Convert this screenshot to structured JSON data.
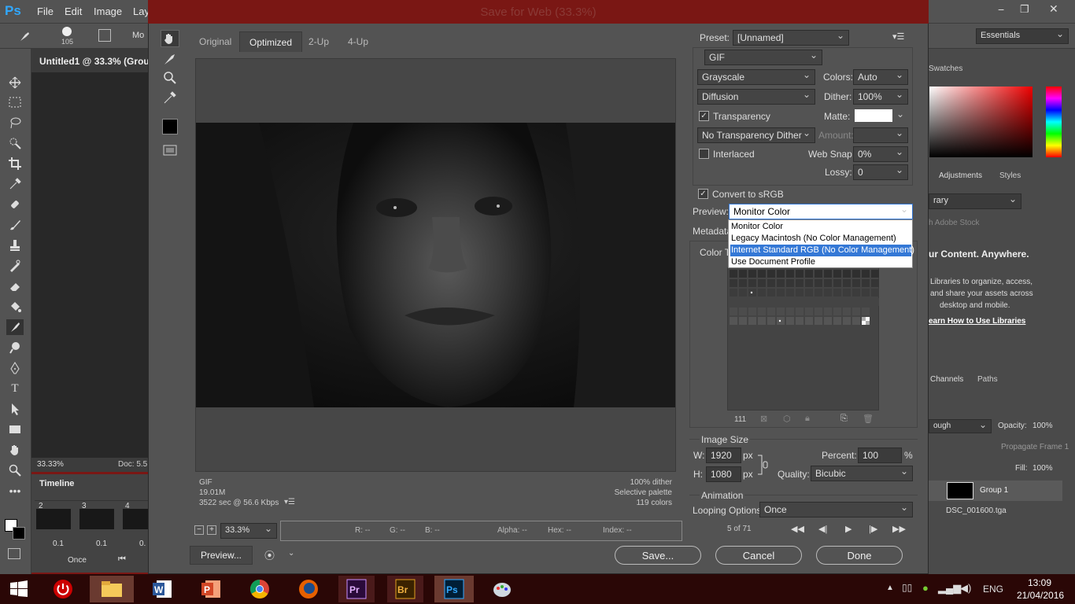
{
  "app": {
    "logo": "Ps",
    "menus": [
      "File",
      "Edit",
      "Image",
      "Lay"
    ],
    "brush_size": "105",
    "options_mode": "Mo",
    "workspace": "Essentials",
    "window_controls": [
      "−",
      "❐",
      "✕"
    ]
  },
  "document": {
    "tab_title": "Untitled1 @ 33.3% (Group",
    "zoom": "33.33%",
    "doc_info": "Doc: 5.5"
  },
  "timeline": {
    "title": "Timeline",
    "frames": [
      {
        "num": "2",
        "delay": "0.1"
      },
      {
        "num": "3",
        "delay": "0.1"
      },
      {
        "num": "4",
        "delay": "0."
      }
    ],
    "loop": "Once"
  },
  "right_panel": {
    "swatches_tab": "Swatches",
    "adjustments_tab": "Adjustments",
    "styles_tab": "Styles",
    "library_dd": "rary",
    "adobe_stock": "h Adobe Stock",
    "promo_title": "ur Content. Anywhere.",
    "promo_text": [
      "Libraries to organize, access,",
      "and share your assets across",
      "desktop and mobile."
    ],
    "promo_link": "earn How to Use Libraries",
    "channels_tab": "Channels",
    "paths_tab": "Paths",
    "blend_mode": "ough",
    "opacity_label": "Opacity:",
    "opacity_val": "100%",
    "propagate": "Propagate Frame 1",
    "fill_label": "Fill:",
    "fill_val": "100%",
    "layers": [
      "Group 1",
      "DSC_001600.tga"
    ]
  },
  "dialog": {
    "title": "Save for Web (33.3%)",
    "tabs": [
      "Original",
      "Optimized",
      "2-Up",
      "4-Up"
    ],
    "info_left": [
      "GIF",
      "19.01M",
      "3522 sec @ 56.6 Kbps"
    ],
    "info_right": [
      "100% dither",
      "Selective palette",
      "119 colors"
    ],
    "zoom": "33.3%",
    "readouts": [
      "R: --",
      "G: --",
      "B: --",
      "Alpha: --",
      "Hex: --",
      "Index: --"
    ],
    "preview_btn": "Preview...",
    "save_btn": "Save...",
    "cancel_btn": "Cancel",
    "done_btn": "Done",
    "preset_label": "Preset:",
    "preset_val": "[Unnamed]",
    "format": "GIF",
    "reduction": "Grayscale",
    "colors_label": "Colors:",
    "colors_val": "Auto",
    "dither_algo": "Diffusion",
    "dither_label": "Dither:",
    "dither_val": "100%",
    "transparency": "Transparency",
    "matte_label": "Matte:",
    "trans_dither": "No Transparency Dither",
    "amount_label": "Amount:",
    "interlaced": "Interlaced",
    "websnap_label": "Web Snap:",
    "websnap_val": "0%",
    "lossy_label": "Lossy:",
    "lossy_val": "0",
    "convert_srgb": "Convert to sRGB",
    "preview_label": "Preview:",
    "preview_val": "Monitor Color",
    "preview_options": [
      "Monitor Color",
      "Legacy Macintosh (No Color Management)",
      "Internet Standard RGB (No Color Management)",
      "Use Document Profile"
    ],
    "metadata_label": "Metadata",
    "color_table_label": "Color Ta",
    "color_count": "111",
    "image_size_label": "Image Size",
    "w_label": "W:",
    "w_val": "1920",
    "h_label": "H:",
    "h_val": "1080",
    "px": "px",
    "percent_label": "Percent:",
    "percent_val": "100",
    "pct": "%",
    "quality_label": "Quality:",
    "quality_val": "Bicubic",
    "animation_label": "Animation",
    "looping_label": "Looping Options:",
    "looping_val": "Once",
    "frame_counter": "5 of 71"
  },
  "taskbar": {
    "lang": "ENG",
    "time": "13:09",
    "date": "21/04/2016"
  }
}
